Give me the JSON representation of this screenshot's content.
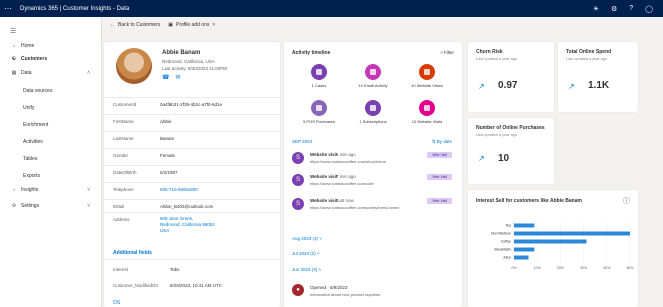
{
  "topbar": {
    "app_title": "Dynamics 365 | Customer Insights - Data"
  },
  "cmdbar": {
    "back_label": "Back to Customers",
    "profile_label": "Profile add ons"
  },
  "sidebar": {
    "items": [
      {
        "label": "Home",
        "icon": "home-icon"
      },
      {
        "label": "Customers",
        "icon": "people-icon"
      },
      {
        "label": "Data",
        "icon": "data-icon"
      },
      {
        "label": "Data sources"
      },
      {
        "label": "Unify"
      },
      {
        "label": "Enrichment"
      },
      {
        "label": "Activities"
      },
      {
        "label": "Tables"
      },
      {
        "label": "Exports"
      },
      {
        "label": "Insights",
        "icon": "bulb-icon"
      },
      {
        "label": "Settings",
        "icon": "gear-icon"
      }
    ]
  },
  "profile": {
    "name": "Abbie Banam",
    "location": "Redmond, California, USA",
    "last_activity": "Last activity: 8/30/2023 11:00PM",
    "fields": [
      {
        "label": "CustomerId",
        "value": "0a4f6b31-2f39-4b2c-a7f0-6d1e"
      },
      {
        "label": "FirstName",
        "value": "Abbie"
      },
      {
        "label": "LastName",
        "value": "Banam"
      },
      {
        "label": "Gender",
        "value": "Female"
      },
      {
        "label": "DateOfBirth",
        "value": "5/2/1987"
      },
      {
        "label": "Telephone",
        "value": "555-710-6666x800"
      },
      {
        "label": "EMail",
        "value": "Abbie_B403@outlook.com"
      }
    ],
    "address_label": "Address",
    "address_lines": [
      "508 Jane Green,",
      "Redmond, California 98052",
      "USA"
    ],
    "additional_header": "Additional fields",
    "additional": [
      {
        "label": "Interest",
        "value": "Tabs"
      },
      {
        "label": "Customer_ModifiedOn",
        "value": "8/29/2023, 10:41 AM UTC"
      }
    ],
    "more_label": "OS"
  },
  "timeline": {
    "title": "Activity timeline",
    "filter_label": "Filter",
    "bubbles": [
      {
        "label": "1 Cases",
        "color": "#7a3fb0"
      },
      {
        "label": "10 Email Activity",
        "color": "#c239b3"
      },
      {
        "label": "10 Website Views",
        "color": "#d83b01"
      },
      {
        "label": "5 POS Purchases",
        "color": "#8764b8"
      },
      {
        "label": "1 Subscriptions",
        "color": "#7a3fb0"
      },
      {
        "label": "10 Website Visits",
        "color": "#e3008c"
      }
    ],
    "group_label": "SEP 2023",
    "sort_label": "By date",
    "items": [
      {
        "title": "Website visit",
        "ago": "5 min ago",
        "url": "https://www.contosocoffee.com/shop/home",
        "badge": "Web Visit"
      },
      {
        "title": "Website visit",
        "ago": "7 min ago",
        "url": "https://www.contosocoffee.com/cafe",
        "badge": "Web Visit"
      },
      {
        "title": "Website visit",
        "ago": "Just now",
        "url": "https://www.contosocoffee.com/pantry/brew-home/",
        "badge": "Web Visit"
      }
    ],
    "periods": [
      "Aug 2023",
      "Jul 2023",
      "Jun 2023"
    ],
    "period_counts": [
      "(4)",
      "(2)",
      "(3)"
    ],
    "opened": {
      "title": "Opened",
      "date": "6/9/2023",
      "desc": "Information about new product inquiries"
    }
  },
  "kpis": [
    {
      "title": "Churn Risk",
      "sub": "Last updated a year ago",
      "value": "0.97"
    },
    {
      "title": "Total Online Spend",
      "sub": "Last updated a year ago",
      "value": "1.1K"
    },
    {
      "title": "Number of Online Purchases",
      "sub": "Last updated a year ago",
      "value": "10"
    }
  ],
  "chart_data": {
    "type": "bar",
    "title": "Interest Sell for customers like Abbie Banam",
    "categories": [
      "Tea",
      "Non Medium",
      "Coffee",
      "Breakfasts",
      "Juice"
    ],
    "values": [
      7,
      40,
      25,
      7,
      5
    ],
    "xlim": [
      0,
      40
    ],
    "x_ticks": [
      "0%",
      "10%",
      "20%",
      "30%",
      "40%",
      "50%"
    ],
    "color": "#2b88d8"
  }
}
